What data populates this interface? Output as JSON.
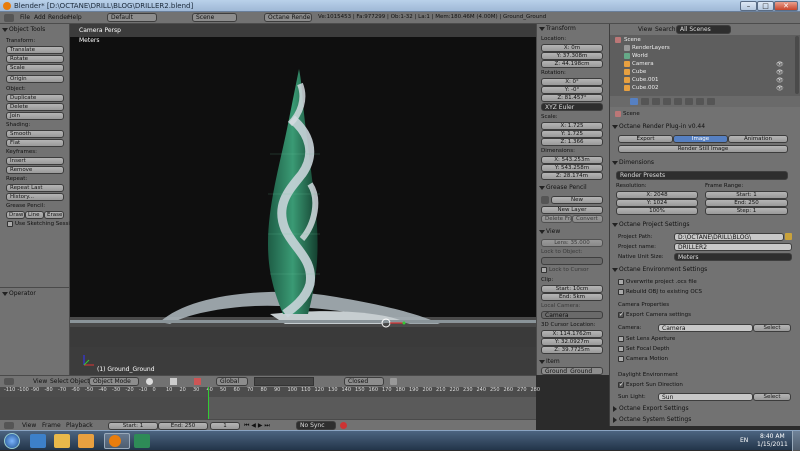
{
  "window": {
    "title": "Blender* [D:\\OCTANE\\DRILL\\BLOG\\DRILLER2.blend]"
  },
  "menubar": {
    "menus": [
      "File",
      "Add",
      "Render",
      "Help"
    ],
    "layout": "Default",
    "scene": "Scene",
    "engine": "Octane Render",
    "stats": "Ve:1015453 | Fa:977299 | Ob:1-32 | La:1 | Mem:180.46M (4.00M) | Ground_Ground"
  },
  "tools": {
    "title": "Object Tools",
    "transform_label": "Transform:",
    "transform": [
      "Translate",
      "Rotate",
      "Scale"
    ],
    "origin": "Origin",
    "object_label": "Object:",
    "object": [
      "Duplicate",
      "Delete",
      "Join"
    ],
    "shading_label": "Shading:",
    "shading": [
      "Smooth",
      "Flat"
    ],
    "keyframes_label": "Keyframes:",
    "keyframes": [
      "Insert",
      "Remove"
    ],
    "repeat_label": "Repeat:",
    "repeat": [
      "Repeat Last",
      "History..."
    ],
    "grease_label": "Grease Pencil:",
    "grease": [
      "Draw",
      "Line",
      "Erase"
    ],
    "sketch": "Use Sketching Sessio",
    "operator": "Operator"
  },
  "viewport": {
    "camera_label": "Camera Persp",
    "units": "Meters",
    "object_label": "(1) Ground_Ground"
  },
  "properties": {
    "transform": "Transform",
    "location": "Location:",
    "loc": [
      "X: 0m",
      "Y: 37.308m",
      "Z: 44.198cm"
    ],
    "rotation": "Rotation:",
    "rot": [
      "X: 0°",
      "Y: -0°",
      "Z: 81.457°"
    ],
    "rot_mode": "XYZ Euler",
    "scale": "Scale:",
    "scl": [
      "X: 1.725",
      "Y: 1.725",
      "Z: 1.366"
    ],
    "dimensions": "Dimensions:",
    "dim": [
      "X: 543.253m",
      "Y: 543.258m",
      "Z: 28.174m"
    ],
    "grease": "Grease Pencil",
    "new": "New",
    "new_layer": "New Layer",
    "delete_frame": "Delete Frame",
    "convert": "Convert",
    "view": "View",
    "lens": "Lens: 35.000",
    "lock_object": "Lock to Object:",
    "lock_cursor": "Lock to Cursor",
    "clip": "Clip:",
    "clip_start": "Start: 10cm",
    "clip_end": "End: 5km",
    "local_camera": "Local Camera:",
    "camera": "Camera",
    "cursor": "3D Cursor Location:",
    "cur": [
      "X: 114.1762m",
      "Y: 32.0927m",
      "Z: 39.7725m"
    ],
    "item": "Item",
    "item_name": "Ground_Ground"
  },
  "outliner": {
    "menus": [
      "View",
      "Search"
    ],
    "filter": "All Scenes",
    "items": [
      "Scene",
      "RenderLayers",
      "World",
      "Camera",
      "Cube",
      "Cube.001",
      "Cube.002"
    ]
  },
  "render": {
    "scene": "Scene",
    "plugin": "Octane Render Plug-in v0.44",
    "tabs": [
      "Export",
      "Image",
      "Animation"
    ],
    "render_still": "Render Still Image",
    "dimensions": "Dimensions",
    "presets": "Render Presets",
    "resolution": "Resolution:",
    "res_x": "X: 2048",
    "res_y": "Y: 1024",
    "res_pct": "100%",
    "frame_range": "Frame Range:",
    "start": "Start: 1",
    "end": "End: 250",
    "step": "Step: 1",
    "project_settings": "Octane Project Settings",
    "project_path_label": "Project Path:",
    "project_path": "D:\\OCTANE\\DRILL\\BLOG\\",
    "project_name_label": "Project name:",
    "project_name": "DRILLER2",
    "unit_label": "Native Unit Size:",
    "unit": "Meters",
    "env": "Octane Environment Settings",
    "overwrite": "Overwrite project .ocs file",
    "rebuild": "Rebuild OBJ to existing OCS",
    "cam_props": "Camera Properties",
    "export_cam": "Export Camera settings",
    "camera_label": "Camera:",
    "camera": "Camera",
    "select": "Select",
    "lens_aperture": "Set Lens Aperture",
    "focal_depth": "Set Focal Depth",
    "camera_motion": "Camera Motion",
    "daylight": "Daylight Environment",
    "export_sun": "Export Sun Direction",
    "sun_label": "Sun Light:",
    "sun": "Sun",
    "export_settings": "Octane Export Settings",
    "system_settings": "Octane System Settings"
  },
  "vheader": {
    "menus": [
      "View",
      "Select",
      "Object"
    ],
    "mode": "Object Mode",
    "pivot": "Global",
    "layer": "Closed"
  },
  "timeline": {
    "ticks": [
      "-110",
      "-100",
      "-90",
      "-80",
      "-70",
      "-60",
      "-50",
      "-40",
      "-30",
      "-20",
      "-10",
      "0",
      "10",
      "20",
      "30",
      "40",
      "50",
      "60",
      "70",
      "80",
      "90",
      "100",
      "110",
      "120",
      "130",
      "140",
      "150",
      "160",
      "170",
      "180",
      "190",
      "200",
      "210",
      "220",
      "230",
      "240",
      "250",
      "260",
      "270",
      "280"
    ]
  },
  "tlheader": {
    "menus": [
      "View",
      "Frame",
      "Playback"
    ],
    "start": "Start: 1",
    "end": "End: 250",
    "current": "1",
    "sync": "No Sync"
  },
  "taskbar": {
    "time": "8:40 AM",
    "date": "1/15/2011",
    "lang": "EN"
  },
  "colors": {
    "panel": "#727272",
    "viewport_sky": "#0f0f0f",
    "building": "#2e7a5e",
    "highlight": "#5680c2"
  }
}
